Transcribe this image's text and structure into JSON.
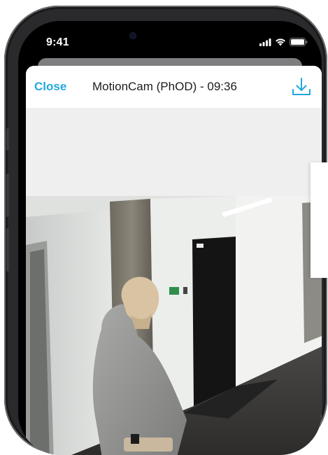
{
  "status_bar": {
    "time": "9:41",
    "icons": [
      "signal-icon",
      "wifi-icon",
      "battery-icon"
    ]
  },
  "nav": {
    "close_label": "Close",
    "title": "MotionCam (PhOD) - 09:36",
    "download_icon": "download-icon"
  },
  "colors": {
    "accent": "#21a7df",
    "sheet_background": "#efeff0",
    "nav_background": "#ffffff"
  },
  "video": {
    "content": "camera-photo"
  }
}
